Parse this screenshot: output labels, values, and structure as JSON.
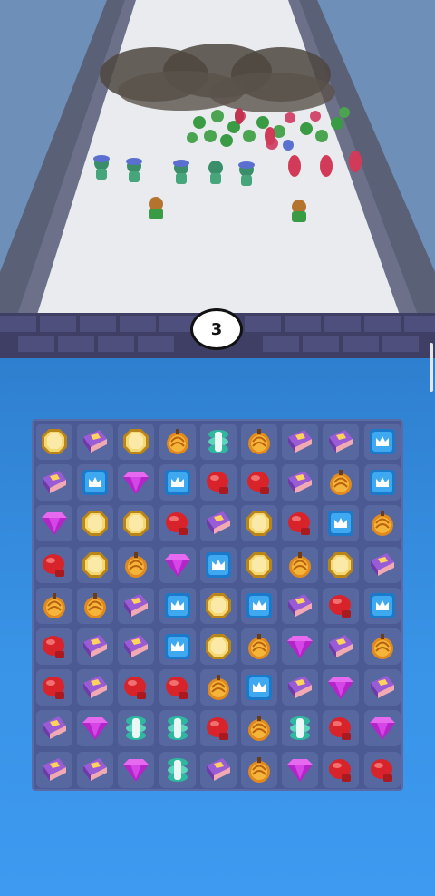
{
  "game": {
    "unit_counter": "3"
  },
  "board": {
    "rows": 9,
    "cols": 9,
    "grid": [
      [
        "gem-gold",
        "book",
        "gem-gold",
        "pumpkin",
        "spring",
        "pumpkin",
        "book",
        "book",
        "crown"
      ],
      [
        "book",
        "crown",
        "diamond",
        "crown",
        "glove",
        "glove",
        "book",
        "pumpkin",
        "crown"
      ],
      [
        "diamond",
        "gem-gold",
        "gem-gold",
        "glove",
        "book",
        "gem-gold",
        "glove",
        "crown",
        "pumpkin"
      ],
      [
        "glove",
        "gem-gold",
        "pumpkin",
        "diamond",
        "crown",
        "gem-gold",
        "pumpkin",
        "gem-gold",
        "book"
      ],
      [
        "pumpkin",
        "pumpkin",
        "book",
        "crown",
        "gem-gold",
        "crown",
        "book",
        "glove",
        "crown"
      ],
      [
        "glove",
        "book",
        "book",
        "crown",
        "gem-gold",
        "pumpkin",
        "diamond",
        "book",
        "pumpkin"
      ],
      [
        "glove",
        "book",
        "glove",
        "glove",
        "pumpkin",
        "crown",
        "book",
        "diamond",
        "book"
      ],
      [
        "book",
        "diamond",
        "spring",
        "spring",
        "glove",
        "pumpkin",
        "spring",
        "glove",
        "diamond"
      ],
      [
        "book",
        "book",
        "diamond",
        "spring",
        "book",
        "pumpkin",
        "diamond",
        "glove",
        "glove"
      ]
    ]
  },
  "colors": {
    "board_bg": "#4b5a92",
    "cell_bg": "#57679f",
    "sky_blue": "#3993e6"
  }
}
